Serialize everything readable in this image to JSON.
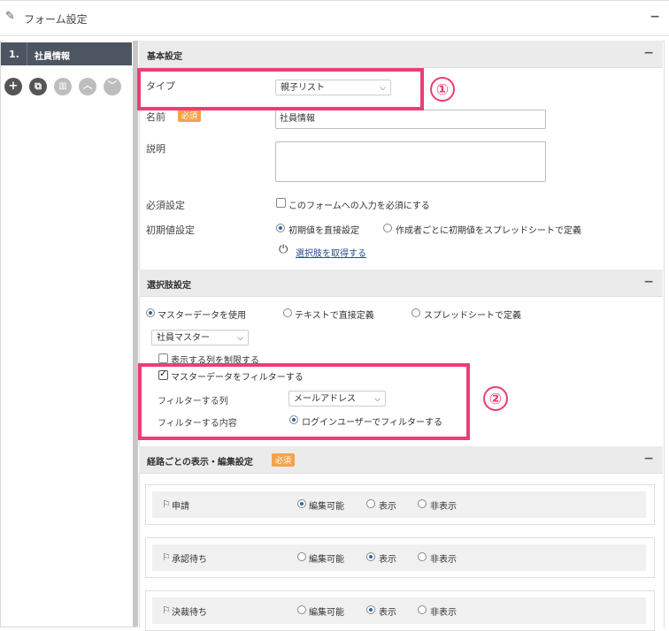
{
  "header": {
    "title": "フォーム設定",
    "collapse_symbol": "−"
  },
  "steps": [
    {
      "number": "1.",
      "name": "社員情報"
    }
  ],
  "toolbar": {
    "icons": [
      "plus-icon",
      "copy-icon",
      "trash-icon",
      "chevron-up-icon",
      "chevron-down-icon"
    ]
  },
  "basic": {
    "title": "基本設定",
    "type_label": "タイプ",
    "type_value": "親子リスト",
    "name_label": "名前",
    "required_badge": "必須",
    "name_value": "社員情報",
    "description_label": "説明",
    "required_setting_label": "必須設定",
    "required_checkbox_label": "このフォームへの入力を必須にする",
    "initial_label": "初期値設定",
    "initial_options": [
      "初期値を直接設定",
      "作成者ごとに初期値をスプレッドシートで定義"
    ],
    "fetch_link": "選択肢を取得する"
  },
  "choices": {
    "title": "選択肢設定",
    "source_options": [
      "マスターデータを使用",
      "テキストで直接定義",
      "スプレッドシートで定義"
    ],
    "master_value": "社員マスター",
    "limit_columns_label": "表示する列を制限する",
    "filter_checkbox_label": "マスターデータをフィルターする",
    "filter_column_label": "フィルターする列",
    "filter_column_value": "メールアドレス",
    "filter_content_label": "フィルターする内容",
    "filter_content_option": "ログインユーザーでフィルターする"
  },
  "routes": {
    "title": "経路ごとの表示・編集設定",
    "required_badge": "必須",
    "options": [
      "編集可能",
      "表示",
      "非表示"
    ],
    "stages": [
      {
        "name": "申請",
        "selected": 0
      },
      {
        "name": "承認待ち",
        "selected": 1
      },
      {
        "name": "決裁待ち",
        "selected": 1
      }
    ]
  },
  "annotations": {
    "marker1": "①",
    "marker2": "②",
    "highlight_color": "#ee3d73"
  }
}
